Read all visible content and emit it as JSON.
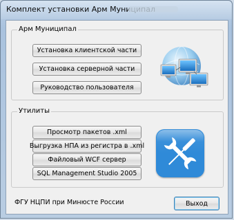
{
  "window": {
    "title": "Комплект установки Арм Муниципал"
  },
  "group_main": {
    "label": "Арм Муниципал",
    "buttons": [
      "Установка клиентской части",
      "Установка серверной части",
      "Руководство пользователя"
    ],
    "icon": "globe-computers-icon"
  },
  "group_utils": {
    "label": "Утилиты",
    "buttons": [
      "Просмотр пакетов .xml",
      "Выгрузка НПА из регистра в .xml",
      "Файловый WCF сервер",
      "SQL Management Studio 2005"
    ],
    "icon": "tools-icon"
  },
  "footer": {
    "org": "ФГУ НЦПИ при Минюсте России",
    "exit_label": "Выход"
  },
  "colors": {
    "accent": "#1f74c6",
    "frame": "#a9c2de"
  }
}
